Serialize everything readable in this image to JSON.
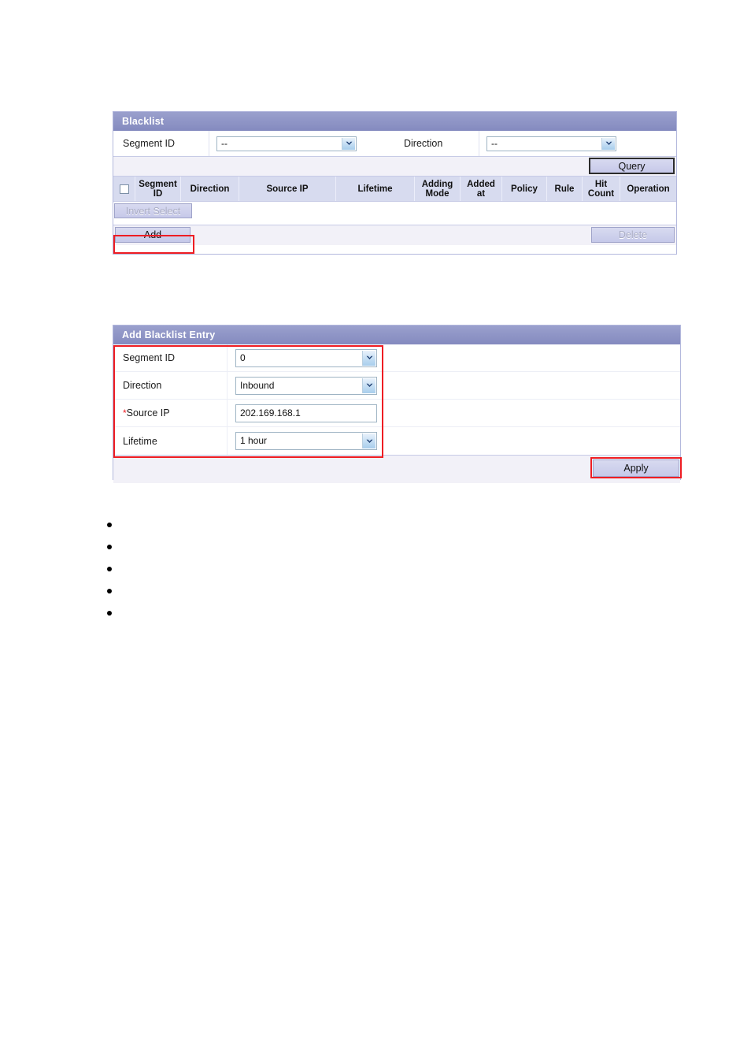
{
  "blacklist_panel": {
    "title": "Blacklist",
    "filters": [
      {
        "label": "Segment ID",
        "value": "--",
        "icon": "chevron-down-icon"
      },
      {
        "label": "Direction",
        "value": "--",
        "icon": "chevron-down-icon"
      }
    ],
    "query_button": "Query",
    "columns": [
      "Segment ID",
      "Direction",
      "Source IP",
      "Lifetime",
      "Adding Mode",
      "Added at",
      "Policy",
      "Rule",
      "Hit Count",
      "Operation"
    ],
    "invert_select_button": "Invert Select",
    "add_button": "Add",
    "delete_button": "Delete"
  },
  "add_entry_panel": {
    "title": "Add Blacklist Entry",
    "fields": [
      {
        "label": "Segment ID",
        "required": false,
        "type": "select",
        "value": "0"
      },
      {
        "label": "Direction",
        "required": false,
        "type": "select",
        "value": "Inbound"
      },
      {
        "label": "Source IP",
        "required": true,
        "type": "text",
        "value": "202.169.168.1"
      },
      {
        "label": "Lifetime",
        "required": false,
        "type": "select",
        "value": "1 hour"
      }
    ],
    "required_marker": "*",
    "apply_button": "Apply"
  },
  "notes": {
    "items": [
      "",
      "",
      "",
      "",
      ""
    ]
  },
  "colors": {
    "panel_header": "#848ABF",
    "highlight": "#ee1d23",
    "grid_header": "#d7dbef",
    "button_face": "#c6c9e9"
  }
}
